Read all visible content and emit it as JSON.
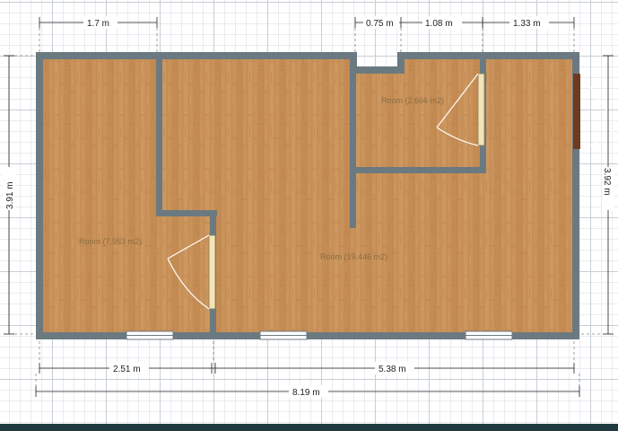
{
  "plan": {
    "dimensions": {
      "top_left": "1.7 m",
      "top_a": "0.75 m",
      "top_b": "1.08 m",
      "top_c": "1.33 m",
      "left_height": "3.91 m",
      "right_height": "3.92 m",
      "bottom_left": "2.51 m",
      "bottom_right": "5.38 m",
      "total_width": "8.19 m"
    },
    "rooms": [
      {
        "label": "Room (7.953 m2)"
      },
      {
        "label": "Room (19.446 m2)"
      },
      {
        "label": "Room (2.666 m2)"
      }
    ]
  },
  "colors": {
    "wall": "#6b7a80",
    "floor": "#c9925a",
    "door": "#f3e3b8",
    "entrance_door": "#6e3a22",
    "dim_line": "#222222",
    "bottom_bar": "#1f3b3f"
  }
}
